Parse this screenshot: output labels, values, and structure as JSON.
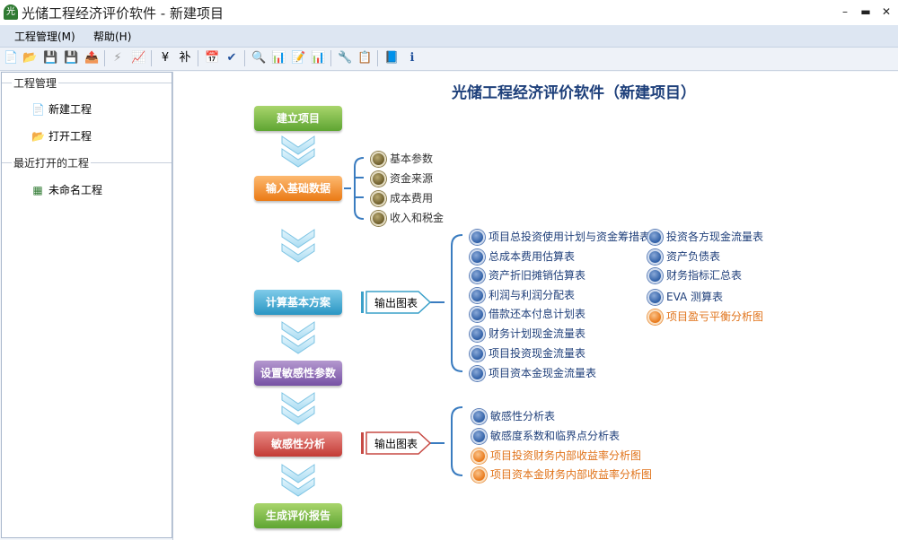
{
  "window": {
    "title": "光储工程经济评价软件 - 新建项目",
    "logo_text": "光"
  },
  "menu": [
    "工程管理(M)",
    "帮助(H)"
  ],
  "sidebar": {
    "group1": "工程管理",
    "new": "新建工程",
    "open": "打开工程",
    "group2": "最近打开的工程",
    "recent": [
      "未命名工程"
    ]
  },
  "main": {
    "title": "光储工程经济评价软件（新建项目）",
    "steps": [
      "建立项目",
      "输入基础数据",
      "计算基本方案",
      "设置敏感性参数",
      "敏感性分析",
      "生成评价报告"
    ],
    "output_label_1": "输出图表",
    "output_label_2": "输出图表",
    "inputs": [
      "基本参数",
      "资金来源",
      "成本费用",
      "收入和税金"
    ],
    "calc_col1": [
      "项目总投资使用计划与资金筹措表",
      "总成本费用估算表",
      "资产折旧摊销估算表",
      "利润与利润分配表",
      "借款还本付息计划表",
      "财务计划现金流量表",
      "项目投资现金流量表",
      "项目资本金现金流量表"
    ],
    "calc_col2": [
      "投资各方现金流量表",
      "资产负债表",
      "财务指标汇总表",
      "EVA 测算表",
      "项目盈亏平衡分析图"
    ],
    "sens": [
      "敏感性分析表",
      "敏感度系数和临界点分析表",
      "项目投资财务内部收益率分析图",
      "项目资本金财务内部收益率分析图"
    ]
  }
}
